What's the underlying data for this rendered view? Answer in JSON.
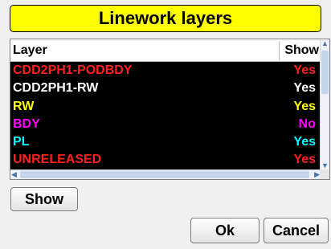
{
  "dialog": {
    "title": "Linework layers"
  },
  "table": {
    "columns": {
      "layer": "Layer",
      "show": "Show"
    },
    "rows": [
      {
        "name": "CDD2PH1-PODBDY",
        "show": "Yes",
        "color": "#ff2020"
      },
      {
        "name": "CDD2PH1-RW",
        "show": "Yes",
        "color": "#ffffff"
      },
      {
        "name": "RW",
        "show": "Yes",
        "color": "#ffff00"
      },
      {
        "name": "BDY",
        "show": "No",
        "color": "#ff00ff"
      },
      {
        "name": "PL",
        "show": "Yes",
        "color": "#00ffff"
      },
      {
        "name": "UNRELEASED",
        "show": "Yes",
        "color": "#ff2020"
      }
    ]
  },
  "buttons": {
    "show": "Show",
    "ok": "Ok",
    "cancel": "Cancel"
  },
  "colors": {
    "title_bg": "#ffff00",
    "table_bg": "#000000"
  }
}
